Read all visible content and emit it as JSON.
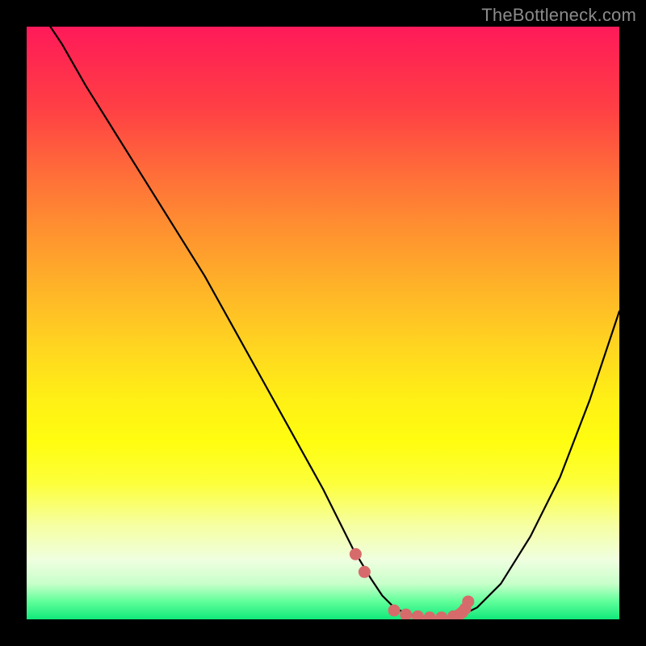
{
  "watermark": "TheBottleneck.com",
  "colors": {
    "curve": "#000000",
    "marker": "#d76b6b",
    "background_black": "#000000"
  },
  "chart_data": {
    "type": "line",
    "title": "",
    "xlabel": "",
    "ylabel": "",
    "xlim": [
      0,
      100
    ],
    "ylim": [
      0,
      100
    ],
    "grid": false,
    "legend": false,
    "curve": {
      "name": "bottleneck-curve",
      "note": "Values are estimated from pixel positions; y is percent from bottom (0) to top (100).",
      "x": [
        4,
        6,
        10,
        15,
        20,
        25,
        30,
        35,
        40,
        45,
        50,
        55,
        58,
        60,
        62,
        64,
        66,
        68,
        70,
        72,
        74,
        76,
        80,
        85,
        90,
        95,
        100
      ],
      "y": [
        100,
        97,
        90,
        82,
        74,
        66,
        58,
        49,
        40,
        31,
        22,
        12,
        7,
        4,
        2,
        1,
        0.5,
        0.3,
        0.3,
        0.5,
        1,
        2,
        6,
        14,
        24,
        37,
        52
      ]
    },
    "markers": {
      "name": "highlighted-region",
      "note": "Points near the curve minimum highlighted in pink.",
      "x": [
        55.5,
        57,
        62,
        64,
        66,
        68,
        70,
        72,
        73,
        73.5,
        74,
        74.5
      ],
      "y": [
        11,
        8,
        1.5,
        0.8,
        0.5,
        0.3,
        0.3,
        0.5,
        0.8,
        1.2,
        1.8,
        3
      ]
    },
    "minimum": {
      "x": 69,
      "y": 0.3
    }
  }
}
